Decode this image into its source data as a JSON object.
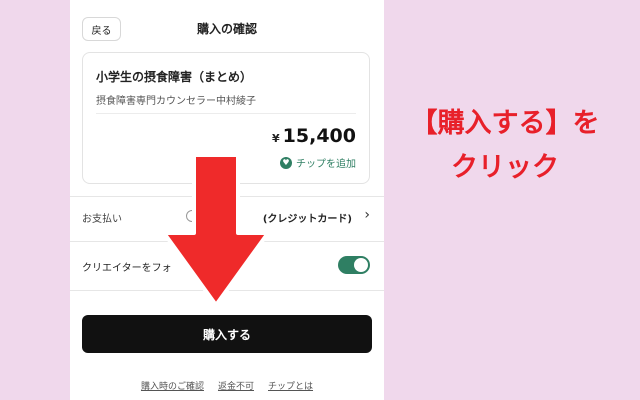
{
  "header": {
    "back_label": "戻る",
    "title": "購入の確認"
  },
  "product": {
    "title": "小学生の摂食障害（まとめ）",
    "author": "摂食障害専門カウンセラー中村綾子",
    "currency": "¥",
    "price": "15,400",
    "tip_label": "チップを追加",
    "tip_icon": "heart-icon"
  },
  "payment": {
    "label": "お支払い",
    "value": "(クレジットカード)"
  },
  "follow": {
    "label": "クリエイターをフォ",
    "enabled": true
  },
  "buy_button": {
    "label": "購入する"
  },
  "footer": {
    "links": [
      "購入時のご確認",
      "返金不可",
      "チップとは"
    ]
  },
  "annotation": {
    "line1": "【購入する】を",
    "line2": "クリック"
  },
  "colors": {
    "background": "#f0d8ec",
    "accent_green": "#2f7f63",
    "arrow_red": "#e8202a",
    "button_black": "#111111"
  }
}
